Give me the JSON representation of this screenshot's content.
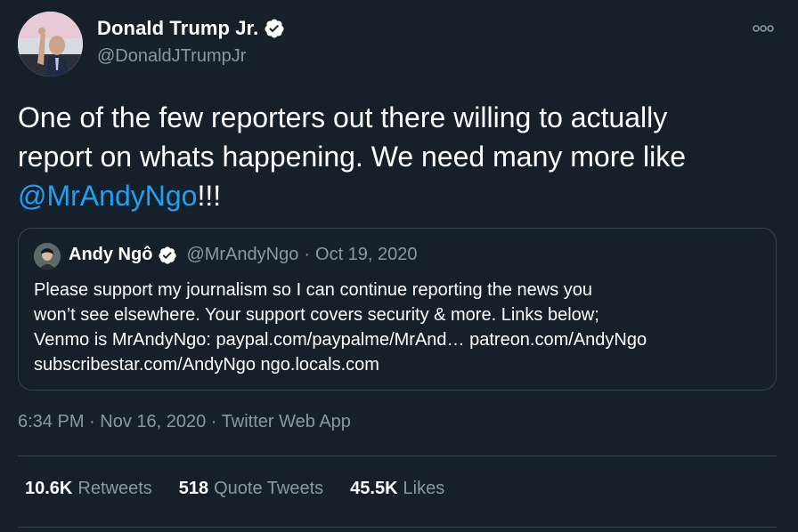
{
  "author": {
    "display_name": "Donald Trump Jr.",
    "handle": "@DonaldJTrumpJr",
    "verified": true
  },
  "tweet": {
    "text_line1": "One of the few reporters out there willing to actually",
    "text_line2": "report on whats happening.  We need many more like",
    "mention": "@MrAndyNgo",
    "text_suffix": "!!!"
  },
  "quoted_tweet": {
    "display_name": "Andy Ngô",
    "handle": "@MrAndyNgo",
    "separator": "·",
    "date": "Oct 19, 2020",
    "verified": true,
    "text_line1": "Please support my journalism so I can continue reporting the news you",
    "text_line2": "won’t see elsewhere. Your support covers security & more. Links below;",
    "text_line3": "Venmo is MrAndyNgo: paypal.com/paypalme/MrAnd… patreon.com/AndyNgo",
    "text_line4": "subscribestar.com/AndyNgo ngo.locals.com"
  },
  "meta": {
    "time": "6:34 PM",
    "sep1": " · ",
    "date": "Nov 16, 2020",
    "sep2": " · ",
    "source": "Twitter Web App"
  },
  "stats": {
    "retweets_count": "10.6K",
    "retweets_label": "Retweets",
    "quote_count": "518",
    "quote_label": "Quote Tweets",
    "likes_count": "45.5K",
    "likes_label": "Likes"
  },
  "icons": {
    "more": "more-icon",
    "verified": "verified-badge-icon"
  },
  "colors": {
    "background": "#15202b",
    "accent": "#1da1f2",
    "secondary_text": "#8899a6",
    "border": "#38444d"
  }
}
